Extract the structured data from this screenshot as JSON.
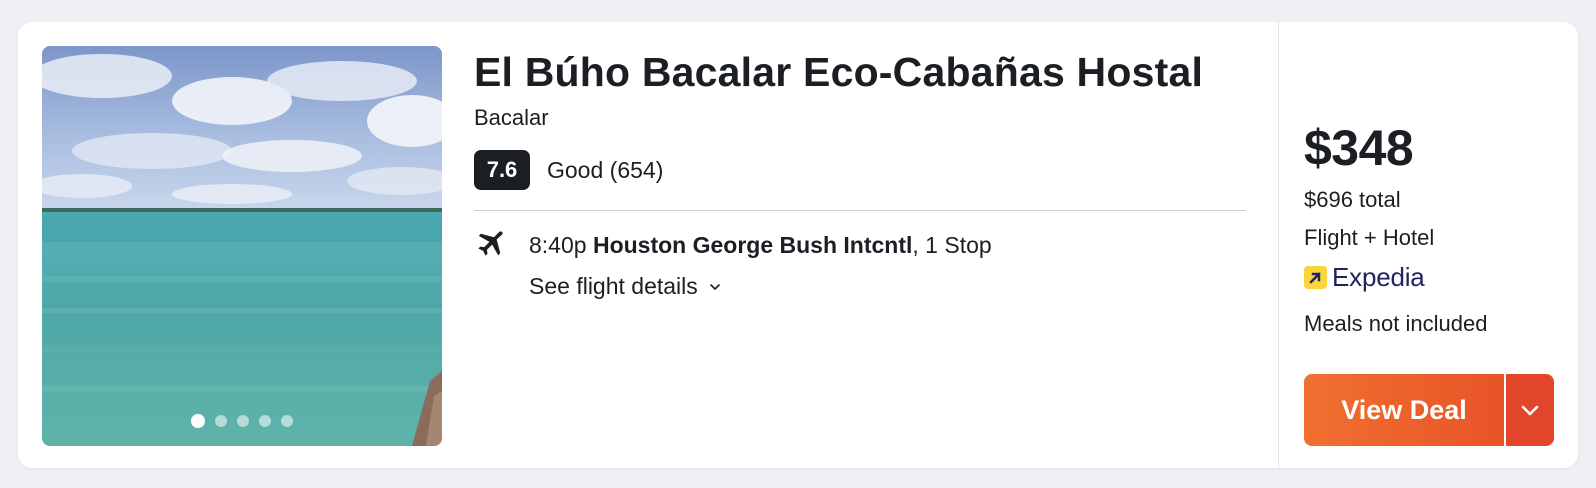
{
  "hotel": {
    "name": "El Búho Bacalar Eco-Cabañas Hostal",
    "location": "Bacalar",
    "rating_score": "7.6",
    "rating_text": "Good (654)",
    "photo_count": 5,
    "active_photo": 1
  },
  "flight": {
    "time": "8:40p",
    "airport": "Houston George Bush Intcntl",
    "stops": ", 1 Stop",
    "details_label": "See flight details",
    "icon": "airplane-icon"
  },
  "pricing": {
    "price": "$348",
    "total": "$696 total",
    "package": "Flight + Hotel",
    "provider": "Expedia",
    "meals": "Meals not included",
    "deal_label": "View Deal"
  },
  "colors": {
    "deal_button_start": "#f07030",
    "deal_button_end": "#e85428",
    "deal_dropdown": "#e2452a",
    "score_badge": "#1b1f24",
    "provider_logo": "#fcd43c"
  }
}
